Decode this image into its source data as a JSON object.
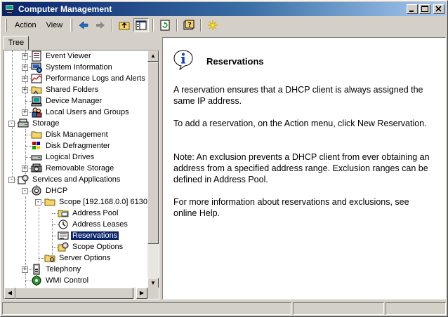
{
  "window": {
    "title": "Computer Management"
  },
  "menu": {
    "action": "Action",
    "view": "View"
  },
  "tabs": {
    "tree": "Tree"
  },
  "tree": {
    "items": [
      {
        "label": "Event Viewer",
        "icon": "event-viewer-icon"
      },
      {
        "label": "System Information",
        "icon": "system-information-icon"
      },
      {
        "label": "Performance Logs and Alerts",
        "icon": "performance-logs-icon"
      },
      {
        "label": "Shared Folders",
        "icon": "shared-folders-icon"
      },
      {
        "label": "Device Manager",
        "icon": "device-manager-icon"
      },
      {
        "label": "Local Users and Groups",
        "icon": "local-users-icon"
      },
      {
        "label": "Storage",
        "icon": "storage-icon"
      },
      {
        "label": "Disk Management",
        "icon": "disk-management-icon"
      },
      {
        "label": "Disk Defragmenter",
        "icon": "disk-defragmenter-icon"
      },
      {
        "label": "Logical Drives",
        "icon": "logical-drives-icon"
      },
      {
        "label": "Removable Storage",
        "icon": "removable-storage-icon"
      },
      {
        "label": "Services and Applications",
        "icon": "services-icon"
      },
      {
        "label": "DHCP",
        "icon": "dhcp-icon"
      },
      {
        "label": "Scope [192.168.0.0] 6130",
        "icon": "folder-icon"
      },
      {
        "label": "Address Pool",
        "icon": "address-pool-icon"
      },
      {
        "label": "Address Leases",
        "icon": "address-leases-icon"
      },
      {
        "label": "Reservations",
        "icon": "reservations-icon"
      },
      {
        "label": "Scope Options",
        "icon": "scope-options-icon"
      },
      {
        "label": "Server Options",
        "icon": "server-options-icon"
      },
      {
        "label": "Telephony",
        "icon": "telephony-icon"
      },
      {
        "label": "WMI Control",
        "icon": "wmi-control-icon"
      }
    ],
    "selected": "Reservations"
  },
  "detail": {
    "title": "Reservations",
    "paragraphs": [
      "A reservation ensures that a DHCP client is always assigned the same IP address.",
      "To add a reservation, on the Action menu, click New Reservation.",
      "Note: An exclusion prevents a DHCP client from ever obtaining an address from a specified address range. Exclusion ranges can be defined in Address Pool.",
      "For more information about reservations and exclusions, see online Help."
    ]
  },
  "colors": {
    "selection": "#0a246a",
    "titlebar_start": "#0a246a",
    "titlebar_end": "#a6caf0",
    "chrome": "#d4d0c8"
  }
}
